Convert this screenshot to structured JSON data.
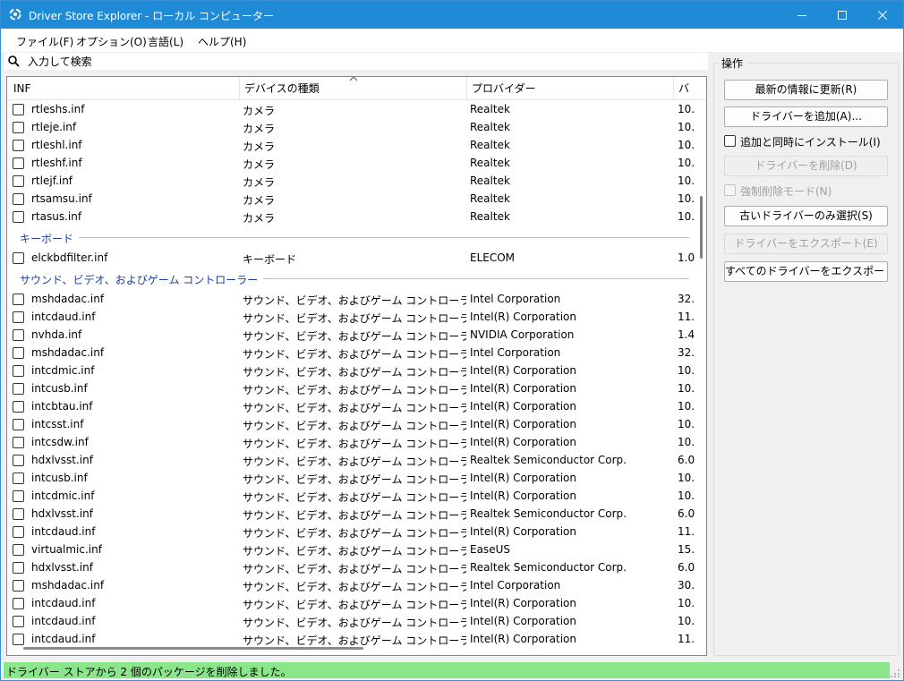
{
  "window": {
    "title": "Driver Store Explorer - ローカル コンピューター"
  },
  "menu": [
    "ファイル(F)",
    "オプション(O)",
    "言語(L)",
    "ヘルプ(H)"
  ],
  "search": {
    "placeholder": "入力して検索"
  },
  "columns": {
    "inf": "INF",
    "type": "デバイスの種類",
    "provider": "プロバイダー",
    "version": "バ"
  },
  "rows_group1": [
    {
      "inf": "rtleshs.inf",
      "type": "カメラ",
      "provider": "Realtek",
      "version": "10."
    },
    {
      "inf": "rtleje.inf",
      "type": "カメラ",
      "provider": "Realtek",
      "version": "10."
    },
    {
      "inf": "rtleshl.inf",
      "type": "カメラ",
      "provider": "Realtek",
      "version": "10."
    },
    {
      "inf": "rtleshf.inf",
      "type": "カメラ",
      "provider": "Realtek",
      "version": "10."
    },
    {
      "inf": "rtlejf.inf",
      "type": "カメラ",
      "provider": "Realtek",
      "version": "10."
    },
    {
      "inf": "rtsamsu.inf",
      "type": "カメラ",
      "provider": "Realtek",
      "version": "10."
    },
    {
      "inf": "rtasus.inf",
      "type": "カメラ",
      "provider": "Realtek",
      "version": "10."
    }
  ],
  "group_keyboard": {
    "label": "キーボード",
    "rows": [
      {
        "inf": "elckbdfilter.inf",
        "type": "キーボード",
        "provider": "ELECOM",
        "version": "1.0"
      }
    ]
  },
  "group_sound": {
    "label": "サウンド、ビデオ、およびゲーム コントローラー",
    "rows": [
      {
        "inf": "mshdadac.inf",
        "type": "サウンド、ビデオ、およびゲーム コントローラー",
        "provider": "Intel Corporation",
        "version": "32."
      },
      {
        "inf": "intcdaud.inf",
        "type": "サウンド、ビデオ、およびゲーム コントローラー",
        "provider": "Intel(R) Corporation",
        "version": "11."
      },
      {
        "inf": "nvhda.inf",
        "type": "サウンド、ビデオ、およびゲーム コントローラー",
        "provider": "NVIDIA Corporation",
        "version": "1.4"
      },
      {
        "inf": "mshdadac.inf",
        "type": "サウンド、ビデオ、およびゲーム コントローラー",
        "provider": "Intel Corporation",
        "version": "32."
      },
      {
        "inf": "intcdmic.inf",
        "type": "サウンド、ビデオ、およびゲーム コントローラー",
        "provider": "Intel(R) Corporation",
        "version": "10."
      },
      {
        "inf": "intcusb.inf",
        "type": "サウンド、ビデオ、およびゲーム コントローラー",
        "provider": "Intel(R) Corporation",
        "version": "10."
      },
      {
        "inf": "intcbtau.inf",
        "type": "サウンド、ビデオ、およびゲーム コントローラー",
        "provider": "Intel(R) Corporation",
        "version": "10."
      },
      {
        "inf": "intcsst.inf",
        "type": "サウンド、ビデオ、およびゲーム コントローラー",
        "provider": "Intel(R) Corporation",
        "version": "10."
      },
      {
        "inf": "intcsdw.inf",
        "type": "サウンド、ビデオ、およびゲーム コントローラー",
        "provider": "Intel(R) Corporation",
        "version": "10."
      },
      {
        "inf": "hdxlvsst.inf",
        "type": "サウンド、ビデオ、およびゲーム コントローラー",
        "provider": "Realtek Semiconductor Corp.",
        "version": "6.0"
      },
      {
        "inf": "intcusb.inf",
        "type": "サウンド、ビデオ、およびゲーム コントローラー",
        "provider": "Intel(R) Corporation",
        "version": "10."
      },
      {
        "inf": "intcdmic.inf",
        "type": "サウンド、ビデオ、およびゲーム コントローラー",
        "provider": "Intel(R) Corporation",
        "version": "10."
      },
      {
        "inf": "hdxlvsst.inf",
        "type": "サウンド、ビデオ、およびゲーム コントローラー",
        "provider": "Realtek Semiconductor Corp.",
        "version": "6.0"
      },
      {
        "inf": "intcdaud.inf",
        "type": "サウンド、ビデオ、およびゲーム コントローラー",
        "provider": "Intel(R) Corporation",
        "version": "11."
      },
      {
        "inf": "virtualmic.inf",
        "type": "サウンド、ビデオ、およびゲーム コントローラー",
        "provider": "EaseUS",
        "version": "15."
      },
      {
        "inf": "hdxlvsst.inf",
        "type": "サウンド、ビデオ、およびゲーム コントローラー",
        "provider": "Realtek Semiconductor Corp.",
        "version": "6.0"
      },
      {
        "inf": "mshdadac.inf",
        "type": "サウンド、ビデオ、およびゲーム コントローラー",
        "provider": "Intel Corporation",
        "version": "30."
      },
      {
        "inf": "intcdaud.inf",
        "type": "サウンド、ビデオ、およびゲーム コントローラー",
        "provider": "Intel(R) Corporation",
        "version": "10."
      },
      {
        "inf": "intcdaud.inf",
        "type": "サウンド、ビデオ、およびゲーム コントローラー",
        "provider": "Intel(R) Corporation",
        "version": "10."
      },
      {
        "inf": "intcdaud.inf",
        "type": "サウンド、ビデオ、およびゲーム コントローラー",
        "provider": "Intel(R) Corporation",
        "version": "11."
      }
    ]
  },
  "ops": {
    "title": "操作",
    "refresh": "最新の情報に更新(R)",
    "add_driver": "ドライバーを追加(A)...",
    "install_checkbox": "追加と同時にインストール(I)",
    "delete_driver": "ドライバーを削除(D)",
    "force_delete": "強制削除モード(N)",
    "select_old": "古いドライバーのみ選択(S)",
    "export_driver": "ドライバーをエクスポート(E)",
    "export_all": "すべてのドライバーをエクスポート(P)..."
  },
  "status": {
    "text": "ドライバー ストアから 2 個のパッケージを削除しました。",
    "color": "#8be68b"
  },
  "colors": {
    "titlebar": "#1f8ad6",
    "group_label": "#1e3f9e"
  }
}
